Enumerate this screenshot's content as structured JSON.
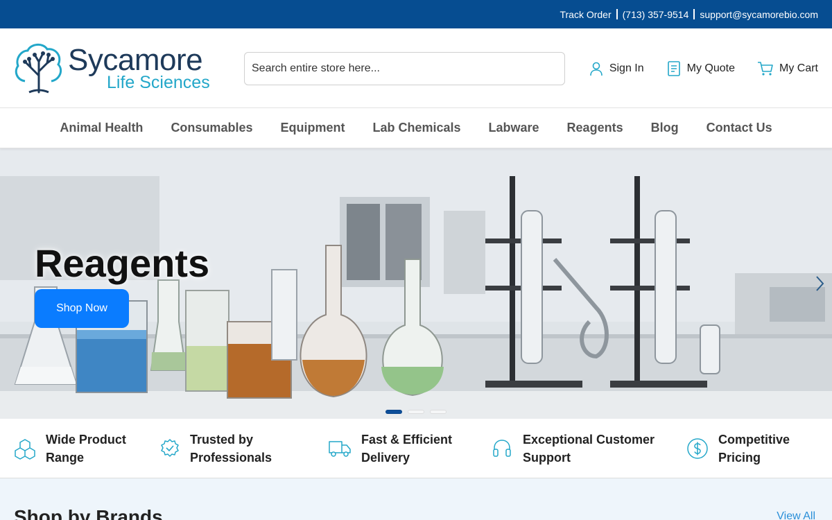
{
  "topbar": {
    "track_order": "Track Order",
    "phone": "(713) 357-9514",
    "email": "support@sycamorebio.com"
  },
  "logo": {
    "main": "Sycamore",
    "sub": "Life Sciences"
  },
  "search": {
    "placeholder": "Search entire store here..."
  },
  "header_links": {
    "sign_in": "Sign In",
    "my_quote": "My Quote",
    "my_cart": "My Cart"
  },
  "nav": {
    "items": [
      {
        "label": "Animal Health"
      },
      {
        "label": "Consumables"
      },
      {
        "label": "Equipment"
      },
      {
        "label": "Lab Chemicals"
      },
      {
        "label": "Labware"
      },
      {
        "label": "Reagents"
      },
      {
        "label": "Blog"
      },
      {
        "label": "Contact Us"
      }
    ]
  },
  "hero": {
    "title": "Reagents",
    "button": "Shop Now",
    "slides_total": 3,
    "active_slide": 1
  },
  "features": [
    {
      "line1": "Wide Product",
      "line2": "Range",
      "icon": "cubes-icon"
    },
    {
      "line1": "Trusted by",
      "line2": "Professionals",
      "icon": "badge-check-icon"
    },
    {
      "line1": "Fast & Efficient",
      "line2": "Delivery",
      "icon": "truck-icon"
    },
    {
      "line1": "Exceptional Customer",
      "line2": "Support",
      "icon": "headset-icon"
    },
    {
      "line1": "Competitive",
      "line2": "Pricing",
      "icon": "dollar-circle-icon"
    }
  ],
  "brands": {
    "title": "Shop by Brands",
    "view_all": "View All"
  },
  "colors": {
    "topbar": "#064d91",
    "accent": "#23a7c9",
    "button": "#0a7cff",
    "logo_dark": "#1e3a5a"
  }
}
